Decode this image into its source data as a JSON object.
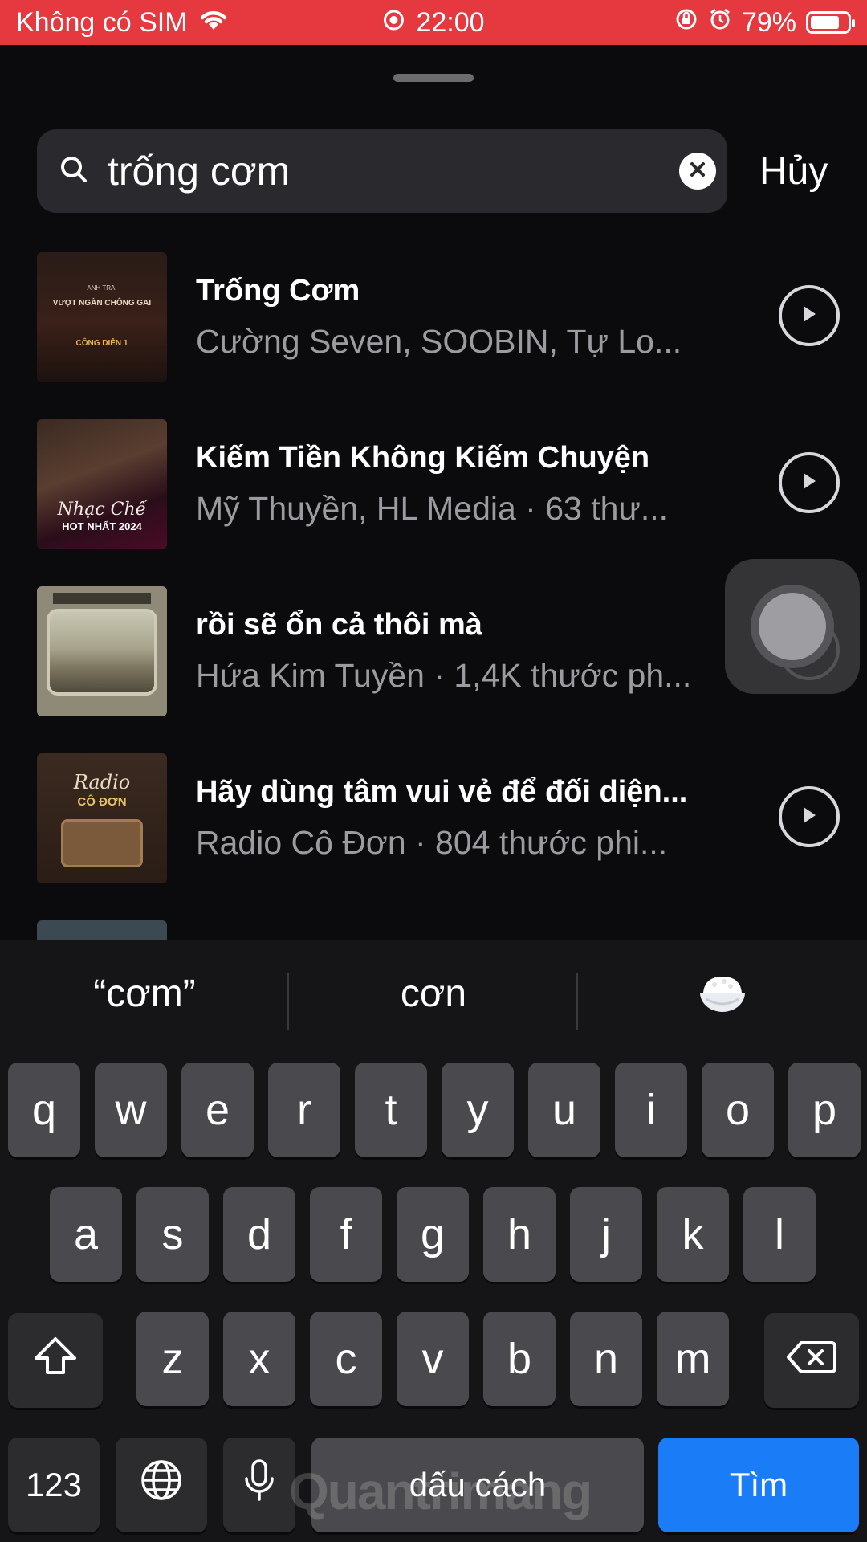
{
  "status_bar": {
    "carrier": "Không có SIM",
    "time": "22:00",
    "battery_percent": "79%",
    "battery_level": 0.79
  },
  "search": {
    "query": "trống cơm",
    "cancel_label": "Hủy"
  },
  "results": [
    {
      "title": "Trống Cơm",
      "subtitle": "Cường Seven, SOOBIN, Tự Lo...",
      "thumb_text": [
        "ANH TRAI",
        "VƯỢT NGÀN CHÔNG GAI",
        "CÔNG DIỄN 1"
      ]
    },
    {
      "title": "Kiếm Tiền Không Kiếm Chuyện",
      "subtitle": "Mỹ Thuyền, HL Media · 63 thư...",
      "thumb_text": [
        "Nhạc Chế",
        "HOT NHẤT 2024"
      ]
    },
    {
      "title": "rồi sẽ ổn cả thôi mà",
      "subtitle": "Hứa Kim Tuyền · 1,4K thước ph...",
      "thumb_text": []
    },
    {
      "title": "Hãy dùng tâm vui vẻ để đối diện...",
      "subtitle": "Radio Cô Đơn · 804 thước phi...",
      "thumb_text": [
        "Radio",
        "CÔ ĐƠN"
      ]
    }
  ],
  "keyboard": {
    "suggestions": [
      "“cơm”",
      "cơn"
    ],
    "row1": [
      "q",
      "w",
      "e",
      "r",
      "t",
      "y",
      "u",
      "i",
      "o",
      "p"
    ],
    "row2": [
      "a",
      "s",
      "d",
      "f",
      "g",
      "h",
      "j",
      "k",
      "l"
    ],
    "row3": [
      "z",
      "x",
      "c",
      "v",
      "b",
      "n",
      "m"
    ],
    "numbers_label": "123",
    "space_label": "dấu cách",
    "search_label": "Tìm"
  },
  "colors": {
    "status_bar": "#e5383f",
    "search_key": "#1a7cf7"
  },
  "watermark": "Quantrimang"
}
